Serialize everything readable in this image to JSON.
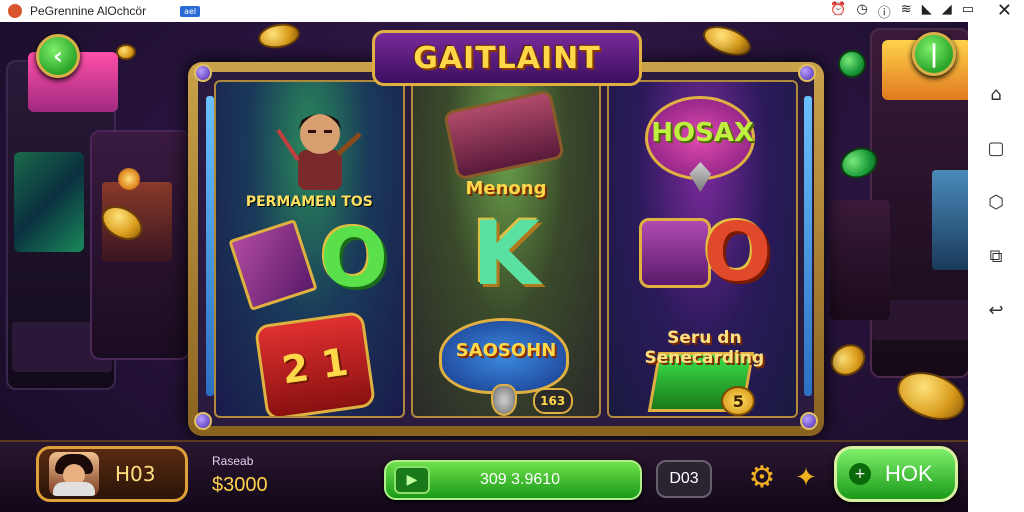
{
  "statusbar": {
    "app_title": "PeGrennine AlOchcör",
    "badge": "ael",
    "icons": [
      "alarm-icon",
      "clock-icon",
      "info-icon",
      "wifi-icon",
      "signal-icon",
      "signal-icon-2",
      "battery-icon"
    ],
    "close": "✕"
  },
  "game": {
    "title": "GAITLAINT",
    "reels": [
      {
        "symbols": [
          {
            "label": "PERMAMEN TOS",
            "kind": "warrior-portrait"
          },
          {
            "label": "",
            "kind": "purple-card"
          },
          {
            "label": "O",
            "kind": "green-zero"
          },
          {
            "label": "2 1",
            "kind": "red-dice"
          }
        ]
      },
      {
        "symbols": [
          {
            "label": "",
            "kind": "treasure-chest"
          },
          {
            "label": "Menong",
            "kind": "text-banner"
          },
          {
            "label": "K",
            "kind": "letter-k"
          },
          {
            "label": "SAOSOHN",
            "kind": "shield-badge"
          },
          {
            "label": "163",
            "kind": "chip"
          }
        ]
      },
      {
        "symbols": [
          {
            "label": "HOSAX",
            "kind": "gem-badge"
          },
          {
            "label": "O",
            "kind": "red-zero"
          },
          {
            "label": "Seru dn Senecarding",
            "kind": "text-banner"
          },
          {
            "label": "5",
            "kind": "green-card"
          }
        ]
      }
    ]
  },
  "player": {
    "name": "H03"
  },
  "balance": {
    "label": "Raseab",
    "value": "$3000"
  },
  "spin": {
    "label": "309 3.9610"
  },
  "bet_box": {
    "label": "D03"
  },
  "hok_button": {
    "label": "HOK"
  },
  "colors": {
    "accent_gold": "#e0b040",
    "accent_green": "#2aa52a",
    "title_yellow": "#ffd84a",
    "balance_yellow": "#ffd24a"
  }
}
